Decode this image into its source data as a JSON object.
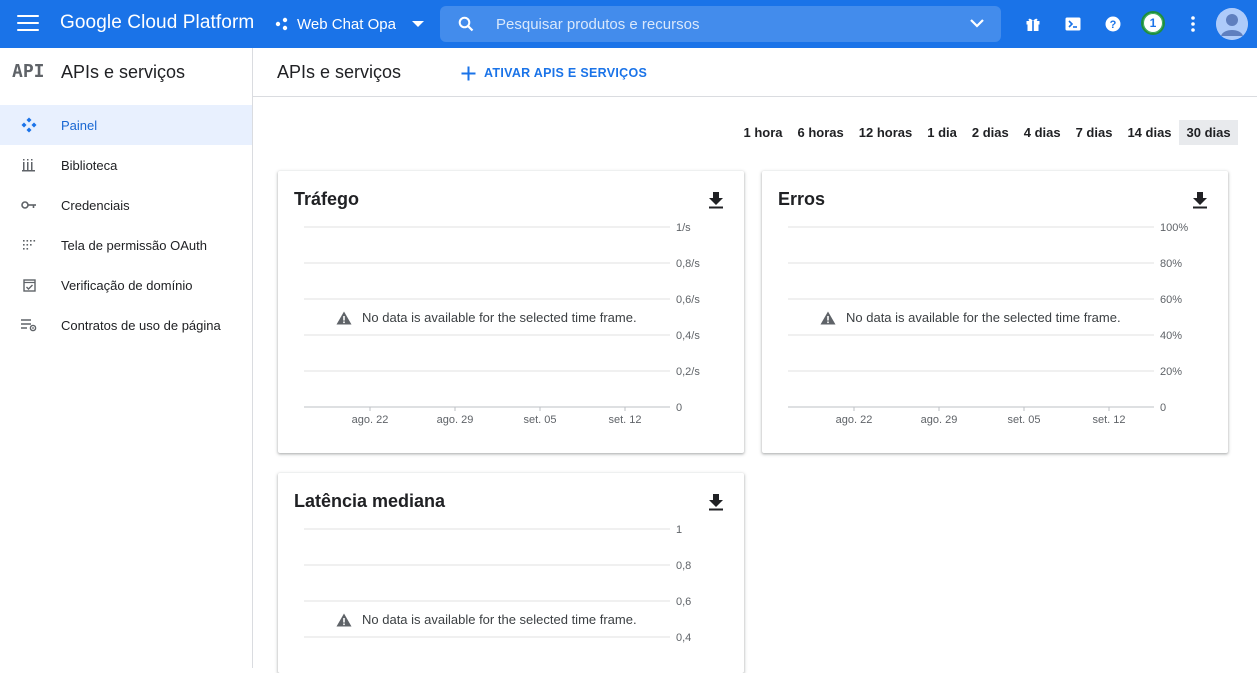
{
  "topbar": {
    "brand": "Google Cloud Platform",
    "project": "Web Chat Opa",
    "search_placeholder": "Pesquisar produtos e recursos",
    "notification_count": "1",
    "color": "#1a73e8"
  },
  "sidebar": {
    "logo": "API",
    "title": "APIs e serviços",
    "items": [
      {
        "label": "Painel",
        "icon": "dashboard-icon",
        "active": true
      },
      {
        "label": "Biblioteca",
        "icon": "library-icon"
      },
      {
        "label": "Credenciais",
        "icon": "key-icon"
      },
      {
        "label": "Tela de permissão OAuth",
        "icon": "oauth-consent-icon"
      },
      {
        "label": "Verificação de domínio",
        "icon": "domain-verification-icon"
      },
      {
        "label": "Contratos de uso de página",
        "icon": "page-usage-agreements-icon"
      }
    ]
  },
  "main": {
    "title": "APIs e serviços",
    "enable_button": "ATIVAR APIS E SERVIÇOS",
    "time_range": [
      "1 hora",
      "6 horas",
      "12 horas",
      "1 dia",
      "2 dias",
      "4 dias",
      "7 dias",
      "14 dias",
      "30 dias"
    ],
    "time_range_selected": "30 dias"
  },
  "chart_data": [
    {
      "type": "line",
      "title": "Tráfego",
      "y_ticks": [
        "1/s",
        "0,8/s",
        "0,6/s",
        "0,4/s",
        "0,2/s",
        "0"
      ],
      "x_ticks": [
        "ago. 22",
        "ago. 29",
        "set. 05",
        "set. 12"
      ],
      "series": [],
      "message": "No data is available for the selected time frame."
    },
    {
      "type": "line",
      "title": "Erros",
      "y_ticks": [
        "100%",
        "80%",
        "60%",
        "40%",
        "20%",
        "0"
      ],
      "x_ticks": [
        "ago. 22",
        "ago. 29",
        "set. 05",
        "set. 12"
      ],
      "series": [],
      "message": "No data is available for the selected time frame."
    },
    {
      "type": "line",
      "title": "Latência mediana",
      "y_ticks": [
        "1",
        "0,8",
        "0,6",
        "0,4"
      ],
      "x_ticks": [],
      "series": [],
      "message": "No data is available for the selected time frame."
    }
  ]
}
